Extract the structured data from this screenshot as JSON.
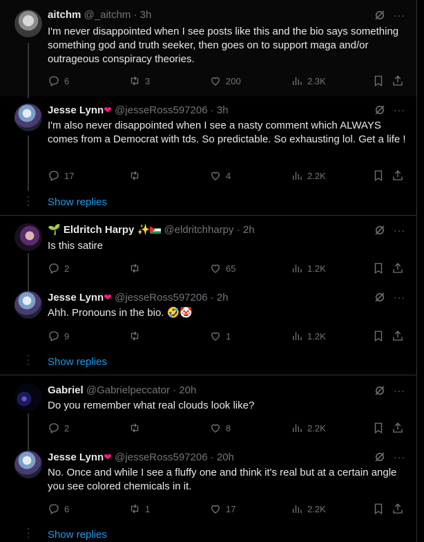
{
  "tweets": [
    {
      "name": "aitchm",
      "handle": "@_aitchm · 3h",
      "text": "I'm never disappointed when I see posts like this and the bio says something something god and truth seeker, then goes on to support maga and/or outrageous conspiracy theories.",
      "replies": "6",
      "reposts": "3",
      "likes": "200",
      "views": "2.3K"
    },
    {
      "name": "Jesse Lynn",
      "handle": "@jesseRoss597206 · 3h",
      "text": "I'm also never disappointed when I see a nasty comment which ALWAYS comes from a Democrat with tds. So predictable. So exhausting lol. Get a life !",
      "replies": "17",
      "reposts": "",
      "likes": "4",
      "views": "2.2K"
    },
    {
      "name": "Eldritch Harpy",
      "handle": "@eldritchharpy · 2h",
      "text": "Is this satire",
      "replies": "2",
      "reposts": "",
      "likes": "65",
      "views": "1.2K"
    },
    {
      "name": "Jesse Lynn",
      "handle": "@jesseRoss597206 · 2h",
      "text": "Ahh. Pronouns in the bio. 🤣🤡",
      "replies": "9",
      "reposts": "",
      "likes": "1",
      "views": "1.2K"
    },
    {
      "name": "Gabriel",
      "handle": "@Gabrielpeccator · 20h",
      "text": "Do you remember what real clouds look like?",
      "replies": "2",
      "reposts": "",
      "likes": "8",
      "views": "2.2K"
    },
    {
      "name": "Jesse Lynn",
      "handle": "@jesseRoss597206 · 20h",
      "text": "No. Once and while I see a fluffy one and think it's real but at a certain angle you see colored chemicals in it.",
      "replies": "6",
      "reposts": "1",
      "likes": "17",
      "views": "2.2K"
    }
  ],
  "show_replies": "Show replies",
  "more_glyph": "···",
  "colors": {
    "accent": "#1d9bf0",
    "heart": "#f91880",
    "muted": "#71767b"
  },
  "icons": [
    "reply-icon",
    "repost-icon",
    "like-icon",
    "views-icon",
    "bookmark-icon",
    "share-icon",
    "grok-icon",
    "more-icon"
  ]
}
